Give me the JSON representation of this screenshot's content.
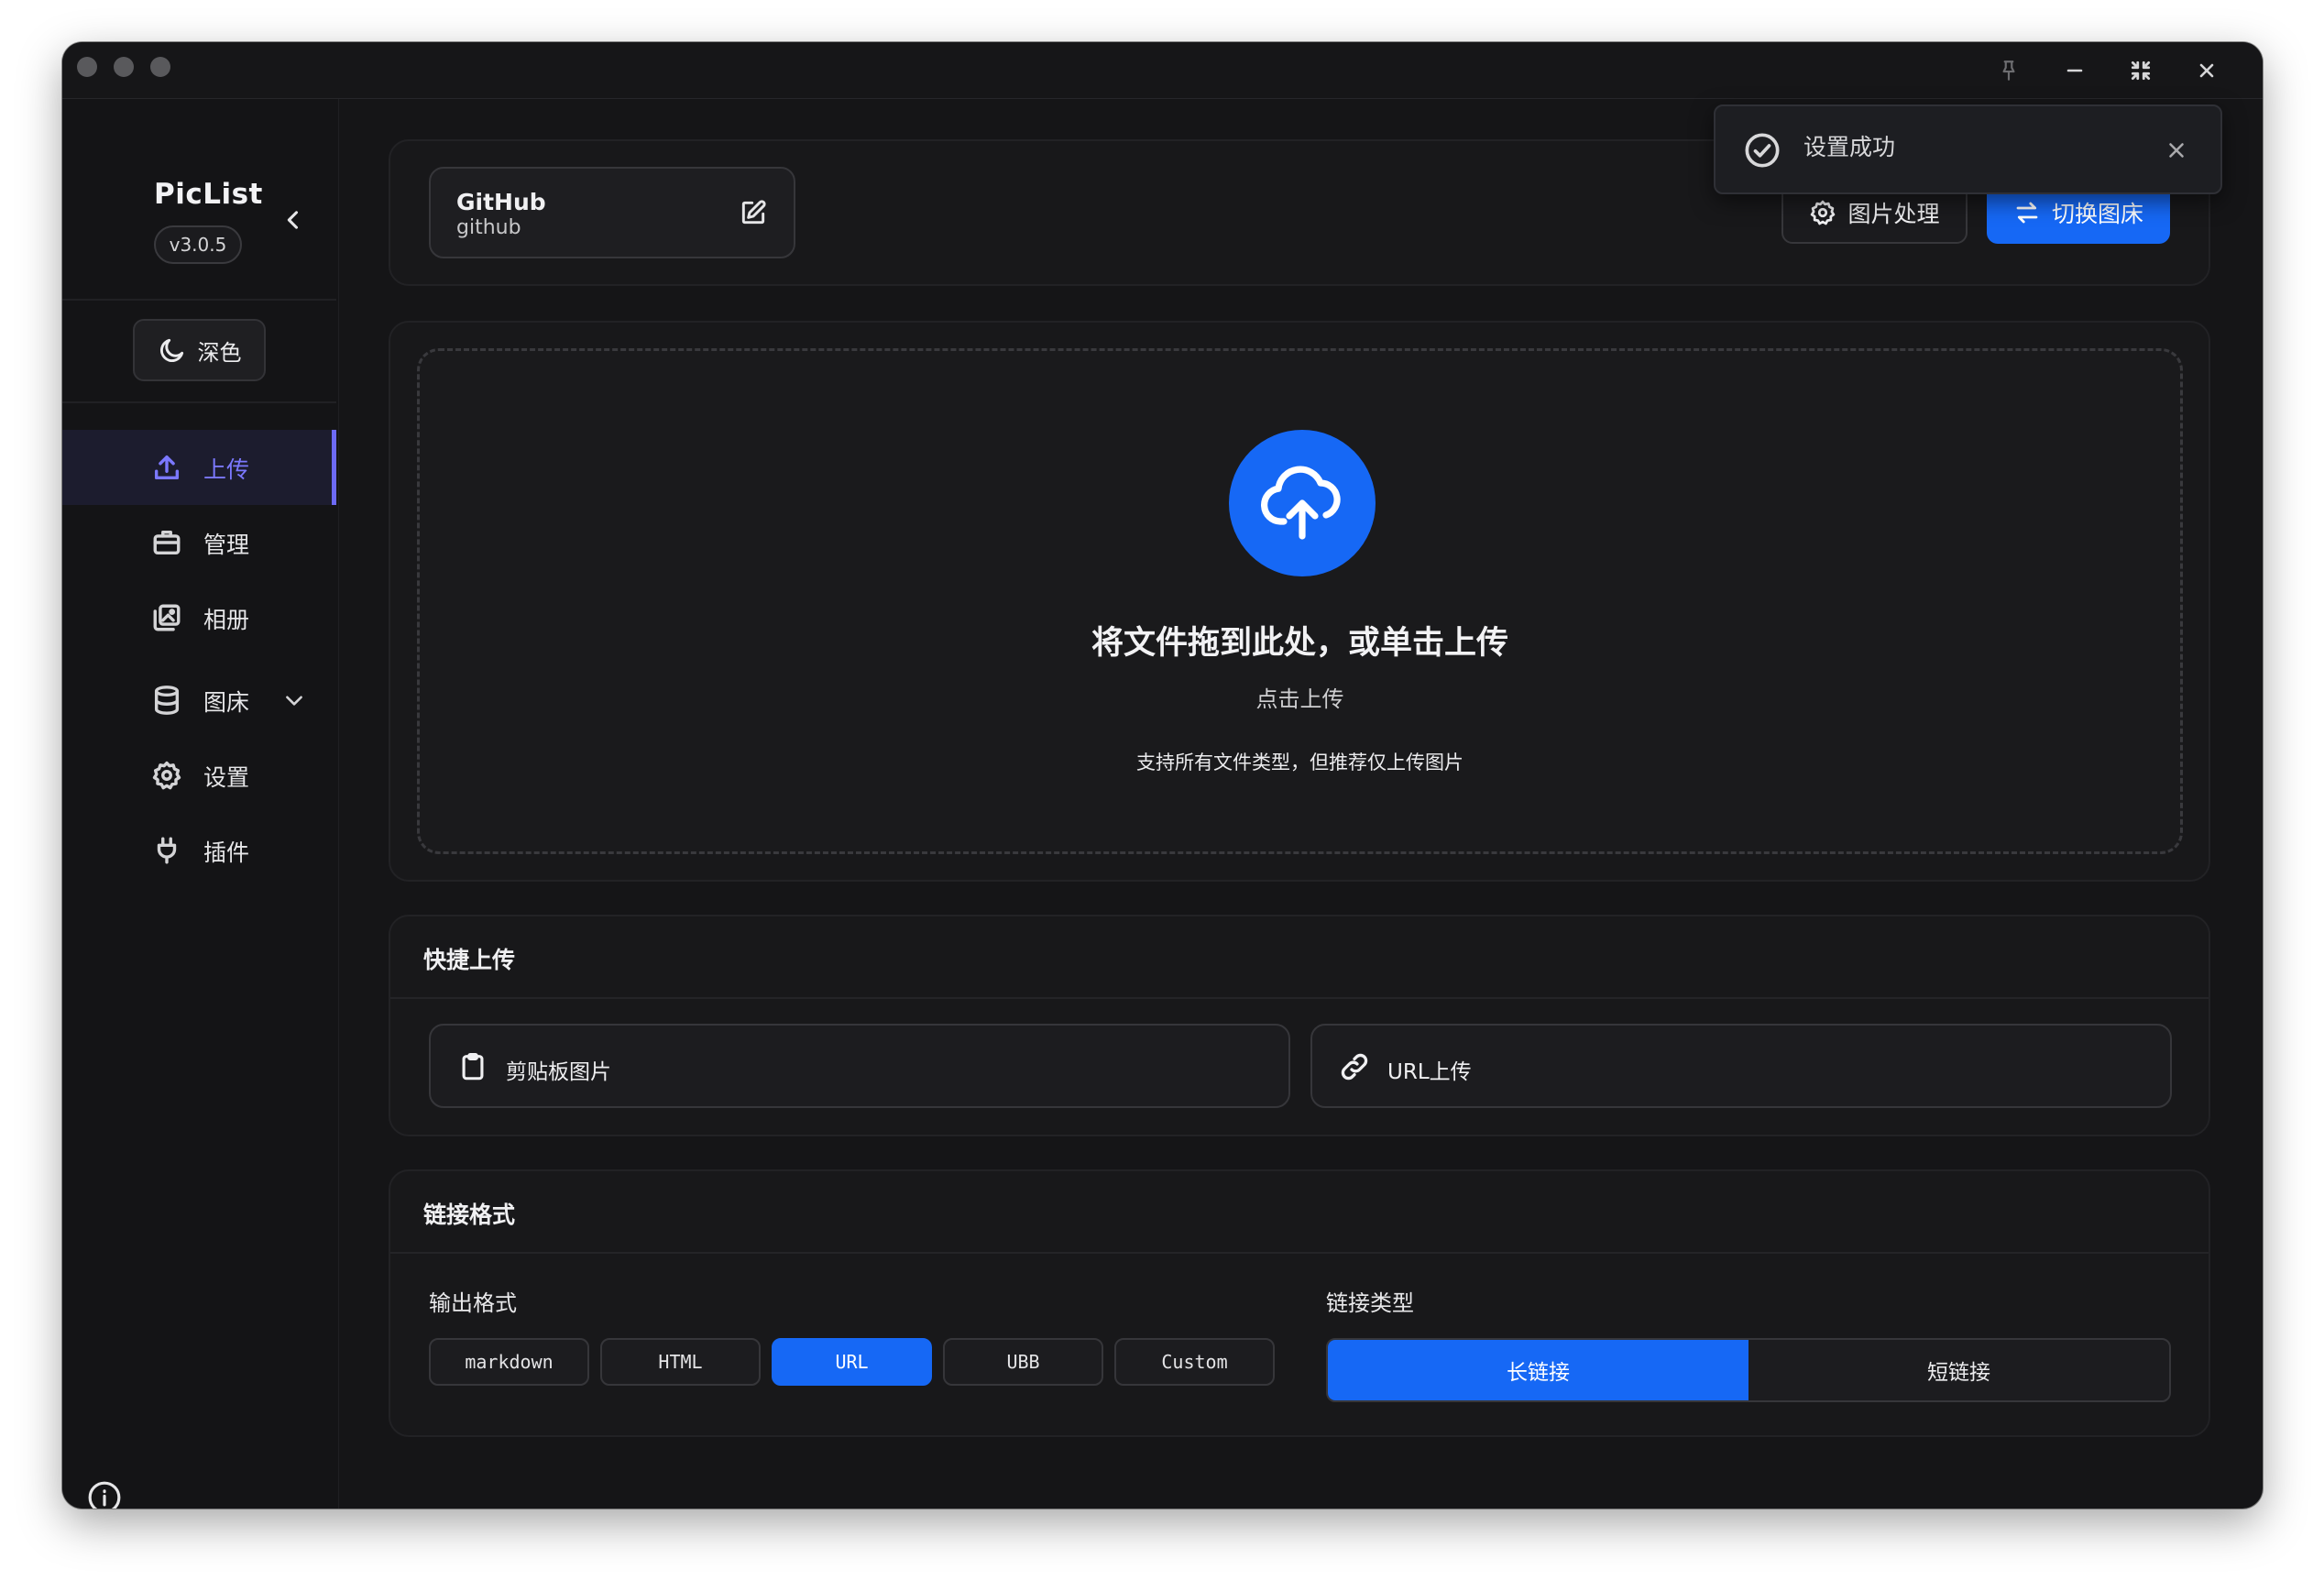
{
  "app": {
    "name": "PicList",
    "version": "v3.0.5"
  },
  "theme_toggle": {
    "label": "深色",
    "icon": "moon-icon"
  },
  "sidebar": {
    "items": [
      {
        "label": "上传",
        "icon": "upload-icon",
        "active": true
      },
      {
        "label": "管理",
        "icon": "briefcase-icon"
      },
      {
        "label": "相册",
        "icon": "gallery-icon"
      },
      {
        "label": "图床",
        "icon": "database-icon",
        "expandable": true
      },
      {
        "label": "设置",
        "icon": "gear-icon"
      },
      {
        "label": "插件",
        "icon": "plug-icon"
      }
    ]
  },
  "host": {
    "name": "GitHub",
    "id": "github"
  },
  "toolbar": {
    "image_process_label": "图片处理",
    "switch_host_label": "切换图床"
  },
  "dropzone": {
    "title": "将文件拖到此处，或单击上传",
    "subtitle": "点击上传",
    "hint": "支持所有文件类型，但推荐仅上传图片"
  },
  "quick_upload": {
    "title": "快捷上传",
    "clipboard_label": "剪贴板图片",
    "url_label": "URL上传"
  },
  "link_format": {
    "title": "链接格式",
    "output_label": "输出格式",
    "formats": [
      "markdown",
      "HTML",
      "URL",
      "UBB",
      "Custom"
    ],
    "selected_format": "URL",
    "link_type_label": "链接类型",
    "link_types": [
      "长链接",
      "短链接"
    ],
    "selected_link_type": "长链接"
  },
  "toast": {
    "message": "设置成功"
  },
  "colors": {
    "accent": "#1668f5",
    "active_nav": "#7b78ff",
    "background": "#151517"
  }
}
